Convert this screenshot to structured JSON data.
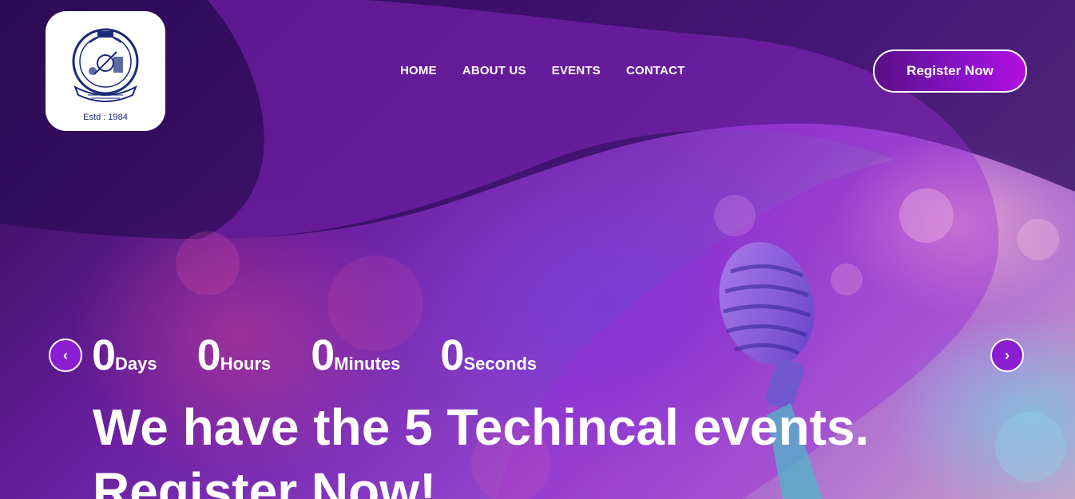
{
  "logo": {
    "estd_text": "Estd : 1984",
    "icon": "college-emblem-icon"
  },
  "nav": {
    "items": [
      {
        "label": "HOME"
      },
      {
        "label": "ABOUT US"
      },
      {
        "label": "EVENTS"
      },
      {
        "label": "CONTACT"
      }
    ]
  },
  "header": {
    "register_label": "Register Now"
  },
  "carousel": {
    "prev_icon": "chevron-left-icon",
    "next_icon": "chevron-right-icon",
    "prev_glyph": "‹",
    "next_glyph": "›"
  },
  "countdown": {
    "days": {
      "value": "0",
      "label": "Days"
    },
    "hours": {
      "value": "0",
      "label": "Hours"
    },
    "minutes": {
      "value": "0",
      "label": "Minutes"
    },
    "seconds": {
      "value": "0",
      "label": "Seconds"
    }
  },
  "hero": {
    "line1": "We have the 5 Techincal events.",
    "line2": "Register Now!"
  },
  "colors": {
    "accent": "#8a1ed0",
    "button_gradient_end": "#b40fe0",
    "text": "#ffffff"
  }
}
